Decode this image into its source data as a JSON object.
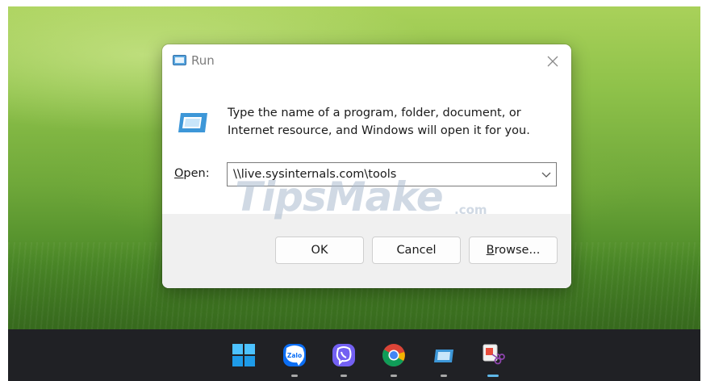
{
  "dialog": {
    "title": "Run",
    "message": "Type the name of a program, folder, document, or Internet resource, and Windows will open it for you.",
    "open_label_u": "O",
    "open_label_rest": "pen:",
    "input_value": "\\\\live.sysinternals.com\\tools",
    "ok_label": "OK",
    "cancel_label": "Cancel",
    "browse_label_u": "B",
    "browse_label_rest": "rowse...",
    "icons": {
      "title": "run-icon",
      "big": "run-icon",
      "close": "close-icon",
      "dropdown": "chevron-down-icon"
    }
  },
  "watermark": {
    "text": "TipsMake",
    "suffix": ".com"
  },
  "taskbar": {
    "items": [
      {
        "name": "start-button",
        "icon": "windows-logo-icon"
      },
      {
        "name": "zalo-app",
        "icon": "zalo-icon",
        "label": "Zalo"
      },
      {
        "name": "viber-app",
        "icon": "viber-icon"
      },
      {
        "name": "chrome-app",
        "icon": "chrome-icon"
      },
      {
        "name": "run-app",
        "icon": "run-icon"
      },
      {
        "name": "snipping-tool-app",
        "icon": "snipping-tool-icon",
        "active": true
      }
    ]
  },
  "colors": {
    "taskbar_bg": "#202125",
    "dialog_bg": "#ffffff",
    "dialog_footer_bg": "#f0f0f0",
    "accent": "#5fb7e8"
  }
}
